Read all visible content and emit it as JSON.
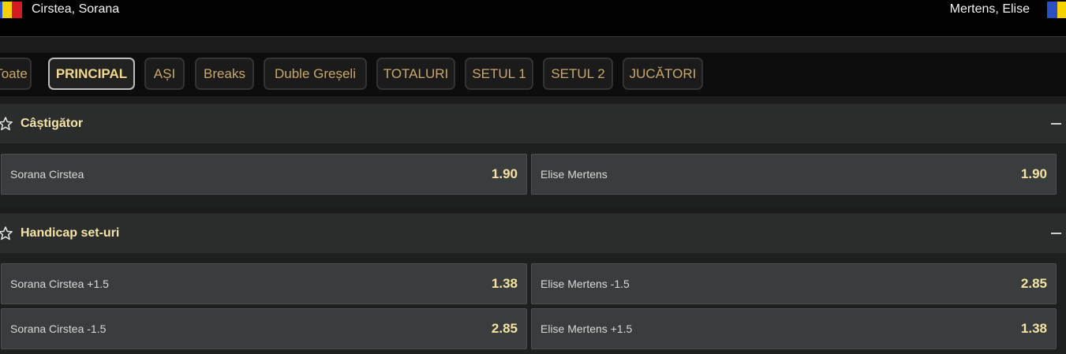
{
  "match": {
    "home": "Cirstea, Sorana",
    "away": "Mertens, Elise",
    "home_flag": [
      "#2b4fc4",
      "#f6d100",
      "#d51b22"
    ],
    "away_flag": [
      "#2b4fc4",
      "#f6d100",
      "#d51b22"
    ]
  },
  "tabs": [
    "Toate",
    "PRINCIPAL",
    "AȘI",
    "Breaks",
    "Duble Greșeli",
    "TOTALURI",
    "SETUL 1",
    "SETUL 2",
    "JUCĂTORI"
  ],
  "active_tab": "PRINCIPAL",
  "markets": [
    {
      "title": "Câștigător",
      "rows": [
        [
          {
            "label": "Sorana Cirstea",
            "price": "1.90"
          },
          {
            "label": "Elise Mertens",
            "price": "1.90"
          }
        ]
      ]
    },
    {
      "title": "Handicap set-uri",
      "rows": [
        [
          {
            "label": "Sorana Cirstea +1.5",
            "price": "1.38"
          },
          {
            "label": "Elise Mertens -1.5",
            "price": "2.85"
          }
        ],
        [
          {
            "label": "Sorana Cirstea -1.5",
            "price": "2.85"
          },
          {
            "label": "Elise Mertens +1.5",
            "price": "1.38"
          }
        ]
      ]
    }
  ],
  "colors": {
    "accent": "#f6e3a3",
    "tab_text": "#c9a86a"
  }
}
